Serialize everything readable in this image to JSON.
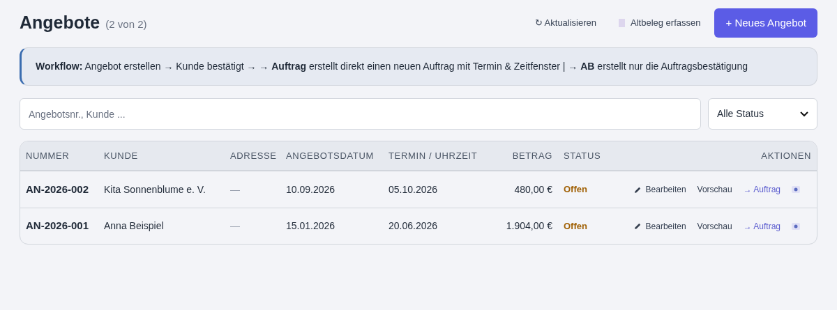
{
  "header": {
    "title": "Angebote",
    "count": "(2 von 2)",
    "refresh": {
      "icon": "↻",
      "label": "Aktualisieren"
    },
    "legacy": "Altbeleg erfassen",
    "primary": "+ Neues Angebot"
  },
  "info": "**Workflow:** Angebot erstellen → Kunde bestätigt → → **Auftrag** erstellt direkt einen neuen Auftrag mit Termin & Zeitfenster | → **AB** erstellt nur die Auftragsbestätigung",
  "search": {
    "placeholder": "Angebotsnr., Kunde ..."
  },
  "status_filter": {
    "value": "Alle Status"
  },
  "table": {
    "columns": [
      "NUMMER",
      "KUNDE",
      "ADRESSE",
      "ANGEBOTSDATUM",
      "TERMIN / UHRZEIT",
      "BETRAG",
      "STATUS",
      "AKTIONEN"
    ],
    "rows": [
      {
        "number": "AN-2026-002",
        "customer": "Kita Sonnenblume e. V.",
        "address": "—",
        "date": "10.09.2026",
        "appointment": "05.10.2026",
        "amount": "480,00 €",
        "status": "Offen",
        "actions": {
          "edit": "Bearbeiten",
          "preview": "Vorschau",
          "order": "→ Auftrag"
        }
      },
      {
        "number": "AN-2026-001",
        "customer": "Anna Beispiel",
        "address": "—",
        "date": "15.01.2026",
        "appointment": "20.06.2026",
        "amount": "1.904,00 €",
        "status": "Offen",
        "actions": {
          "edit": "Bearbeiten",
          "preview": "Vorschau",
          "order": "→ Auftrag"
        }
      }
    ]
  }
}
